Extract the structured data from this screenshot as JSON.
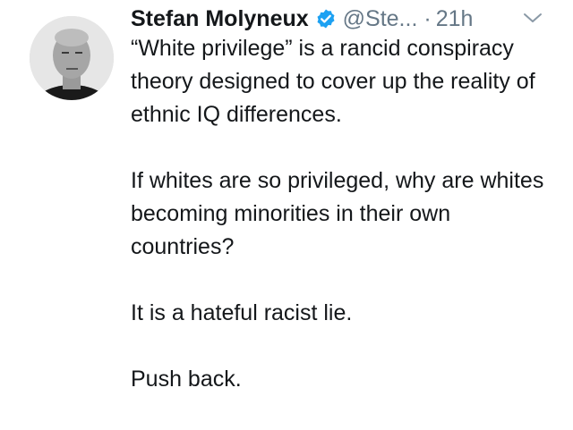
{
  "tweet": {
    "display_name": "Stefan Molyneux",
    "handle": "@Ste...",
    "separator": "·",
    "time": "21h",
    "paragraphs": [
      "“White privilege” is a rancid conspiracy theory designed to cover up the reality of ethnic IQ differences.",
      "If whites are so privileged, why are whites becoming minorities in their own countries?",
      "It is a hateful racist lie.",
      "Push back."
    ],
    "icons": {
      "verified": "verified-badge-icon",
      "menu": "chevron-down-icon"
    },
    "colors": {
      "text": "#14171a",
      "secondary": "#657786",
      "verified": "#1da1f2"
    }
  }
}
